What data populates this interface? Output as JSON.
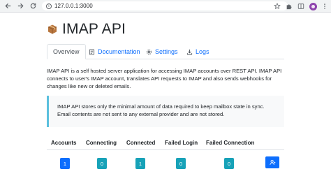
{
  "browser": {
    "url": "127.0.0.1:3000"
  },
  "header": {
    "title": "IMAP API"
  },
  "tabs": [
    {
      "label": "Overview",
      "active": true
    },
    {
      "label": "Documentation",
      "icon": "document-icon"
    },
    {
      "label": "Settings",
      "icon": "gear-icon"
    },
    {
      "label": "Logs",
      "icon": "download-icon"
    }
  ],
  "intro": "IMAP API is a self hosted server application for accessing IMAP accounts over REST API. IMAP API connects to user's IMAP account, translates API requests to IMAP and also sends webhooks for changes like new or deleted emails.",
  "callout": "IMAP API stores only the minimal amount of data required to keep mailbox state in sync. Email contents are not sent to any external provider and are not stored.",
  "stats": {
    "headers": [
      "Accounts",
      "Connecting",
      "Connected",
      "Failed Login",
      "Failed Connection"
    ],
    "values": [
      "1",
      "0",
      "1",
      "0",
      "0"
    ]
  },
  "colors": {
    "primary": "#0d6efd",
    "info": "#17a2b8",
    "callout_border": "#5bc0de"
  }
}
